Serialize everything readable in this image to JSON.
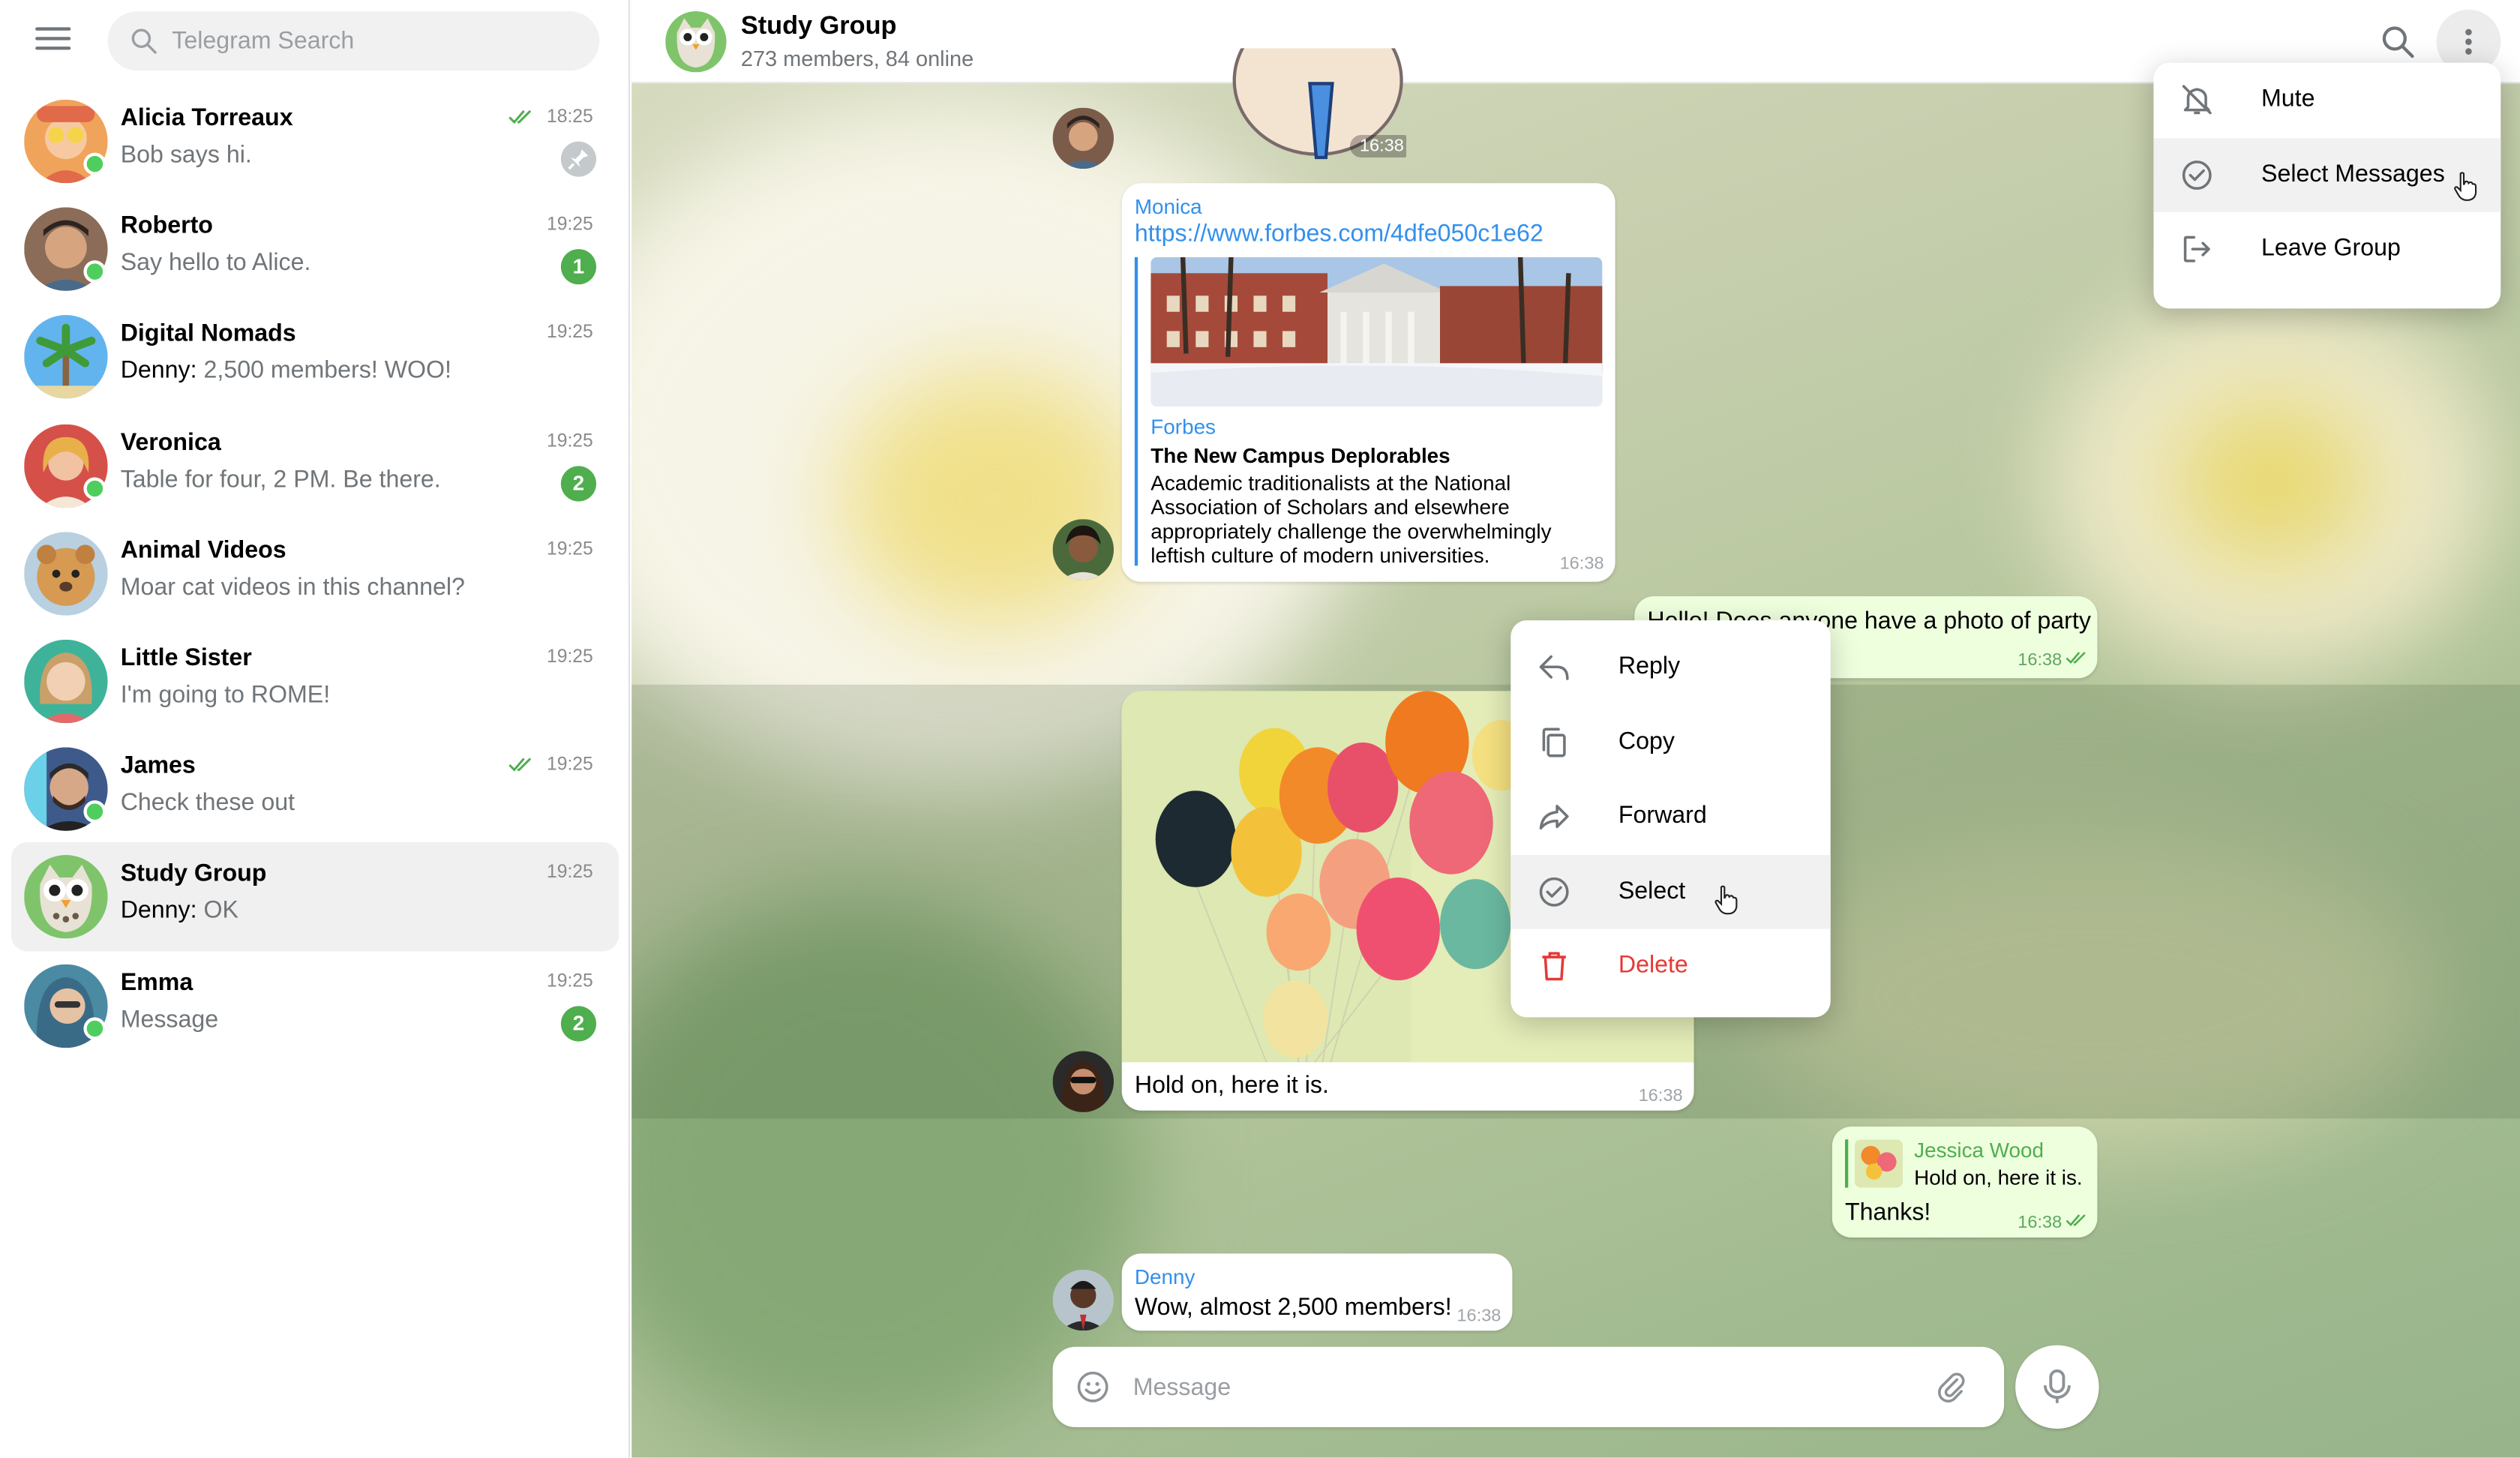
{
  "search": {
    "placeholder": "Telegram Search"
  },
  "chats": [
    {
      "name": "Alicia Torreaux",
      "time": "18:25",
      "sender": "",
      "message": "Bob says hi.",
      "badge": "",
      "pinned": true,
      "read": true,
      "online": true,
      "avatar_color": "#f0a35a"
    },
    {
      "name": "Roberto",
      "time": "19:25",
      "sender": "",
      "message": "Say hello to Alice.",
      "badge": "1",
      "online": true,
      "avatar_color": "#7b5b4a"
    },
    {
      "name": "Digital Nomads",
      "time": "19:25",
      "sender": "Denny: ",
      "message": "2,500 members! WOO!",
      "badge": "",
      "online": false,
      "avatar_color": "#5aa3e0"
    },
    {
      "name": "Veronica",
      "time": "19:25",
      "sender": "",
      "message": "Table for four, 2 PM. Be there.",
      "badge": "2",
      "online": true,
      "avatar_color": "#d9534f"
    },
    {
      "name": "Animal Videos",
      "time": "19:25",
      "sender": "",
      "message": "Moar cat videos in this channel?",
      "badge": "",
      "online": false,
      "avatar_color": "#c8904f"
    },
    {
      "name": "Little Sister",
      "time": "19:25",
      "sender": "",
      "message": "I'm going to ROME!",
      "badge": "",
      "online": false,
      "avatar_color": "#5db3a8"
    },
    {
      "name": "James",
      "time": "19:25",
      "sender": "",
      "message": "Check these out",
      "badge": "",
      "read": true,
      "online": true,
      "avatar_color": "#4a6fa5"
    },
    {
      "name": "Study Group",
      "time": "19:25",
      "sender": "Denny: ",
      "message": "OK",
      "badge": "",
      "online": false,
      "active": true,
      "avatar_color": "#7cc06a"
    },
    {
      "name": "Emma",
      "time": "19:25",
      "sender": "",
      "message": "Message",
      "badge": "2",
      "online": true,
      "avatar_color": "#4a90a8"
    }
  ],
  "header": {
    "title": "Study Group",
    "subtitle": "273 members, 84 online"
  },
  "messages": {
    "sticker_time": "16:38",
    "link": {
      "sender": "Monica",
      "url": "https://www.forbes.com/4dfe050c1e62",
      "site": "Forbes",
      "title": "The New Campus Deplorables",
      "description": "Academic traditionalists at the National Association of Scholars and elsewhere appropriately challenge the overwhelmingly leftish culture of modern universities.",
      "time": "16:38"
    },
    "party": {
      "text": "Hello! Does anyone have a photo of party",
      "time": "16:38"
    },
    "photo": {
      "caption": "Hold on, here it is.",
      "time": "16:38"
    },
    "thanks": {
      "reply_name": "Jessica Wood",
      "reply_text": "Hold on, here it is.",
      "text": "Thanks!",
      "time": "16:38"
    },
    "denny": {
      "sender": "Denny",
      "text": "Wow, almost 2,500 members!",
      "time": "16:38"
    }
  },
  "context_menu": [
    "Reply",
    "Copy",
    "Forward",
    "Select",
    "Delete"
  ],
  "header_menu": [
    "Mute",
    "Select Messages",
    "Leave Group"
  ],
  "composer": {
    "placeholder": "Message"
  },
  "colors": {
    "accent": "#3390ec",
    "online": "#4fce5d",
    "badge": "#4fae4e",
    "outgoing": "#eeffde",
    "danger": "#e53935"
  }
}
